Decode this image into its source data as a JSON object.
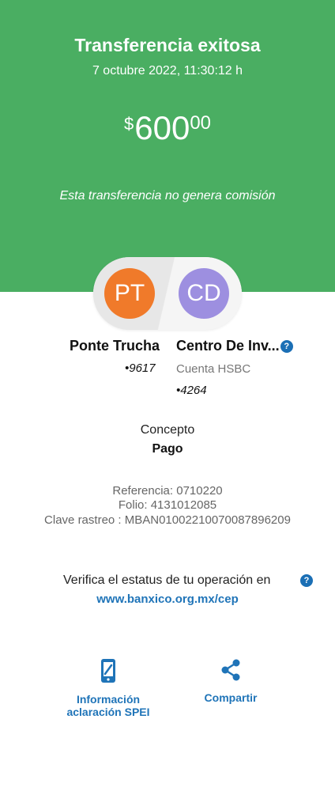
{
  "header": {
    "title": "Transferencia exitosa",
    "datetime": "7 octubre 2022, 11:30:12 h",
    "amount_currency": "$",
    "amount_integer": "600",
    "amount_decimals": "00",
    "commission_note": "Esta transferencia no genera comisión"
  },
  "sender": {
    "initials": "PT",
    "name": "Ponte Trucha",
    "account": "•9617"
  },
  "recipient": {
    "initials": "CD",
    "name": "Centro De Inv...",
    "bank": "Cuenta HSBC",
    "account": "•4264"
  },
  "concept": {
    "label": "Concepto",
    "value": "Pago"
  },
  "references": {
    "referencia": "Referencia: 0710220",
    "folio": "Folio: 4131012085",
    "clave_rastreo": "Clave rastreo : MBAN01002210070087896209"
  },
  "verify": {
    "text": "Verifica el estatus de tu operación en",
    "link": "www.banxico.org.mx/cep"
  },
  "actions": {
    "info_line1": "Información",
    "info_line2": "aclaración SPEI",
    "share": "Compartir"
  },
  "colors": {
    "header_green": "#4aae62",
    "sender_orange": "#f07a2a",
    "recipient_purple": "#9d8fe0",
    "link_blue": "#1f74b8"
  },
  "icons": [
    "help-icon",
    "phone-info-icon",
    "share-icon"
  ]
}
